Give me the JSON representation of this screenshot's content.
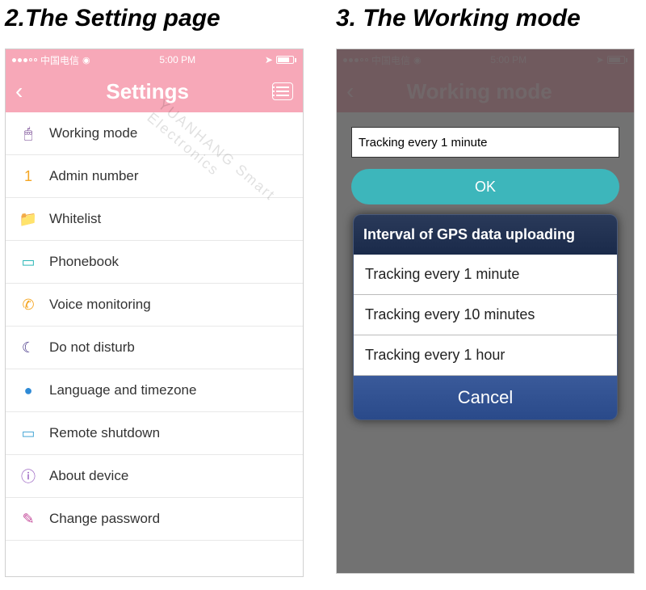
{
  "titles": {
    "left": "2.The Setting page",
    "right": "3. The Working mode"
  },
  "statusbar": {
    "carrier": "中国电信",
    "time": "5:00 PM"
  },
  "settings": {
    "title": "Settings",
    "items": [
      {
        "icon": "mouse-icon",
        "glyph": "🖱",
        "color": "#6b3a8a",
        "label": "Working mode"
      },
      {
        "icon": "number-icon",
        "glyph": "1",
        "color": "#f5a623",
        "label": "Admin number"
      },
      {
        "icon": "folder-icon",
        "glyph": "📁",
        "color": "#e68a2e",
        "label": "Whitelist"
      },
      {
        "icon": "book-icon",
        "glyph": "▭",
        "color": "#2eb8b8",
        "label": "Phonebook"
      },
      {
        "icon": "phone-icon",
        "glyph": "✆",
        "color": "#f5a623",
        "label": "Voice monitoring"
      },
      {
        "icon": "moon-icon",
        "glyph": "☾",
        "color": "#4a3a8a",
        "label": "Do not disturb"
      },
      {
        "icon": "globe-icon",
        "glyph": "●",
        "color": "#2e8ad6",
        "label": "Language and timezone"
      },
      {
        "icon": "laptop-icon",
        "glyph": "▭",
        "color": "#4aa8d6",
        "label": "Remote shutdown"
      },
      {
        "icon": "info-icon",
        "glyph": "ⓘ",
        "color": "#8a4ab8",
        "label": "About device"
      },
      {
        "icon": "edit-icon",
        "glyph": "✎",
        "color": "#c44a9a",
        "label": "Change password"
      }
    ]
  },
  "working_mode": {
    "title": "Working mode",
    "field_value": "Tracking every 1 minute",
    "ok_label": "OK",
    "dialog": {
      "header": "Interval of GPS data uploading",
      "options": [
        "Tracking every 1 minute",
        "Tracking every 10 minutes",
        "Tracking every 1 hour"
      ],
      "cancel": "Cancel"
    }
  },
  "watermark": "YUANHANG Smart Electronics"
}
